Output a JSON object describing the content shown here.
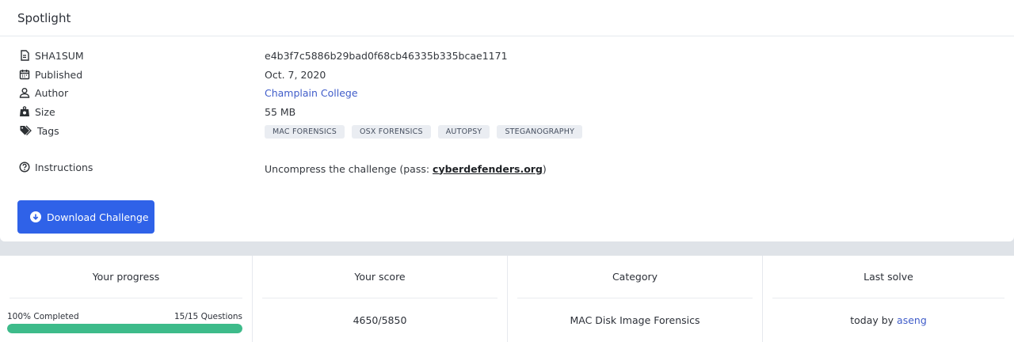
{
  "card": {
    "title": "Spotlight",
    "meta": [
      {
        "label": "SHA1SUM",
        "value": "e4b3f7c5886b29bad0f68cb46335b335bcae1171"
      },
      {
        "label": "Published",
        "value": "Oct. 7, 2020"
      },
      {
        "label": "Author",
        "value": "Champlain College"
      },
      {
        "label": "Size",
        "value": "55 MB"
      },
      {
        "label": "Tags"
      },
      {
        "label": "Instructions"
      }
    ],
    "tags": [
      "MAC FORENSICS",
      "OSX FORENSICS",
      "AUTOPSY",
      "STEGANOGRAPHY"
    ],
    "instructions": {
      "prefix": "Uncompress the challenge (pass: ",
      "password": "cyberdefenders.org",
      "suffix": ")"
    },
    "download_label": "Download Challenge"
  },
  "stats": {
    "progress": {
      "title": "Your progress",
      "completed_label": "100% Completed",
      "questions_label": "15/15 Questions",
      "fraction": 1.0
    },
    "score": {
      "title": "Your score",
      "value": "4650/5850"
    },
    "category": {
      "title": "Category",
      "value": "MAC Disk Image Forensics"
    },
    "last_solve": {
      "title": "Last solve",
      "prefix": "today by ",
      "user": "aseng"
    }
  },
  "colors": {
    "accent": "#2f62e8",
    "link": "#3f5cc9",
    "progress": "#3dbb8a"
  }
}
